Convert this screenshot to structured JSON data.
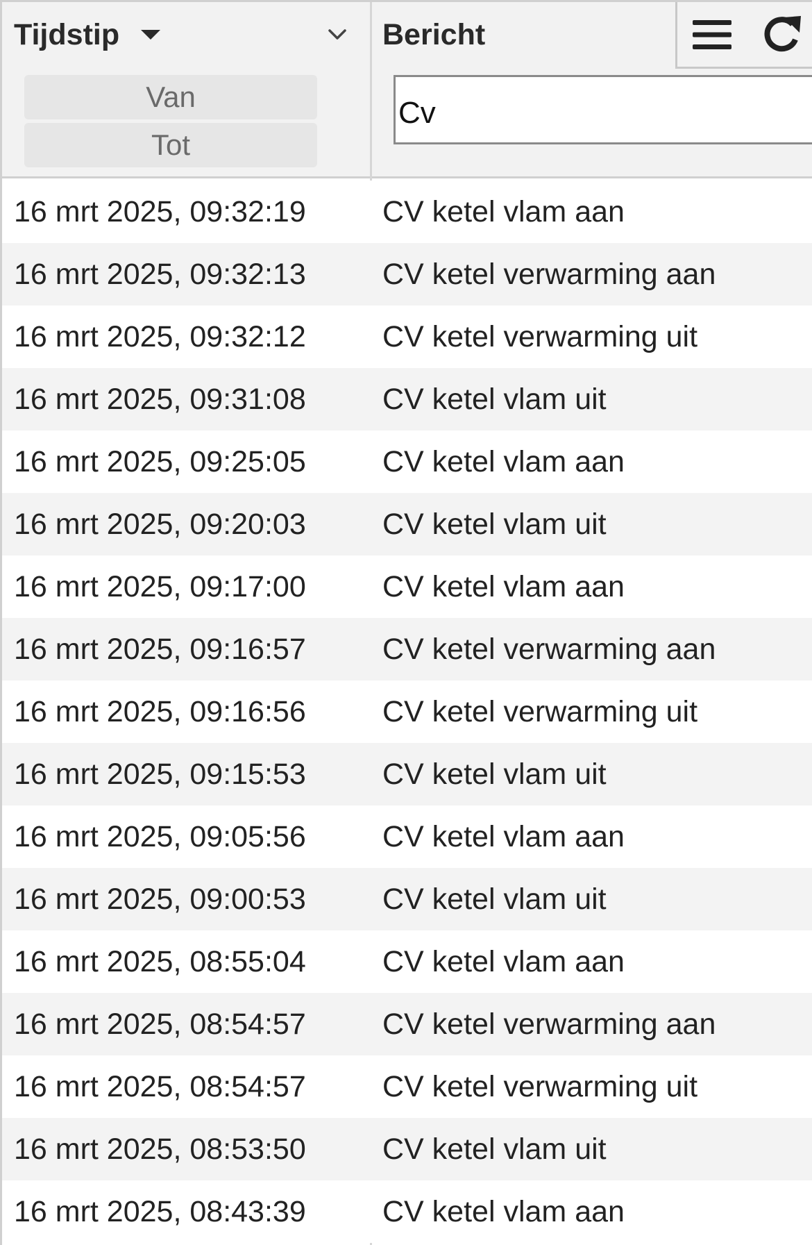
{
  "header": {
    "time_column": "Tijdstip",
    "message_column": "Bericht",
    "range_from": "Van",
    "range_to": "Tot",
    "filter_value": "Cv"
  },
  "toolbar": {
    "menu_icon": "menu-icon",
    "refresh_icon": "refresh-icon"
  },
  "rows": [
    {
      "time": "16 mrt 2025, 09:32:19",
      "message": "CV ketel vlam aan"
    },
    {
      "time": "16 mrt 2025, 09:32:13",
      "message": "CV ketel verwarming aan"
    },
    {
      "time": "16 mrt 2025, 09:32:12",
      "message": "CV ketel verwarming uit"
    },
    {
      "time": "16 mrt 2025, 09:31:08",
      "message": "CV ketel vlam uit"
    },
    {
      "time": "16 mrt 2025, 09:25:05",
      "message": "CV ketel vlam aan"
    },
    {
      "time": "16 mrt 2025, 09:20:03",
      "message": "CV ketel vlam uit"
    },
    {
      "time": "16 mrt 2025, 09:17:00",
      "message": "CV ketel vlam aan"
    },
    {
      "time": "16 mrt 2025, 09:16:57",
      "message": "CV ketel verwarming aan"
    },
    {
      "time": "16 mrt 2025, 09:16:56",
      "message": "CV ketel verwarming uit"
    },
    {
      "time": "16 mrt 2025, 09:15:53",
      "message": "CV ketel vlam uit"
    },
    {
      "time": "16 mrt 2025, 09:05:56",
      "message": "CV ketel vlam aan"
    },
    {
      "time": "16 mrt 2025, 09:00:53",
      "message": "CV ketel vlam uit"
    },
    {
      "time": "16 mrt 2025, 08:55:04",
      "message": "CV ketel vlam aan"
    },
    {
      "time": "16 mrt 2025, 08:54:57",
      "message": "CV ketel verwarming aan"
    },
    {
      "time": "16 mrt 2025, 08:54:57",
      "message": "CV ketel verwarming uit"
    },
    {
      "time": "16 mrt 2025, 08:53:50",
      "message": "CV ketel vlam uit"
    },
    {
      "time": "16 mrt 2025, 08:43:39",
      "message": "CV ketel vlam aan"
    }
  ],
  "colors": {
    "header_bg": "#f2f2f2",
    "row_alt_bg": "#f3f3f3",
    "border": "#d0d0d0"
  }
}
